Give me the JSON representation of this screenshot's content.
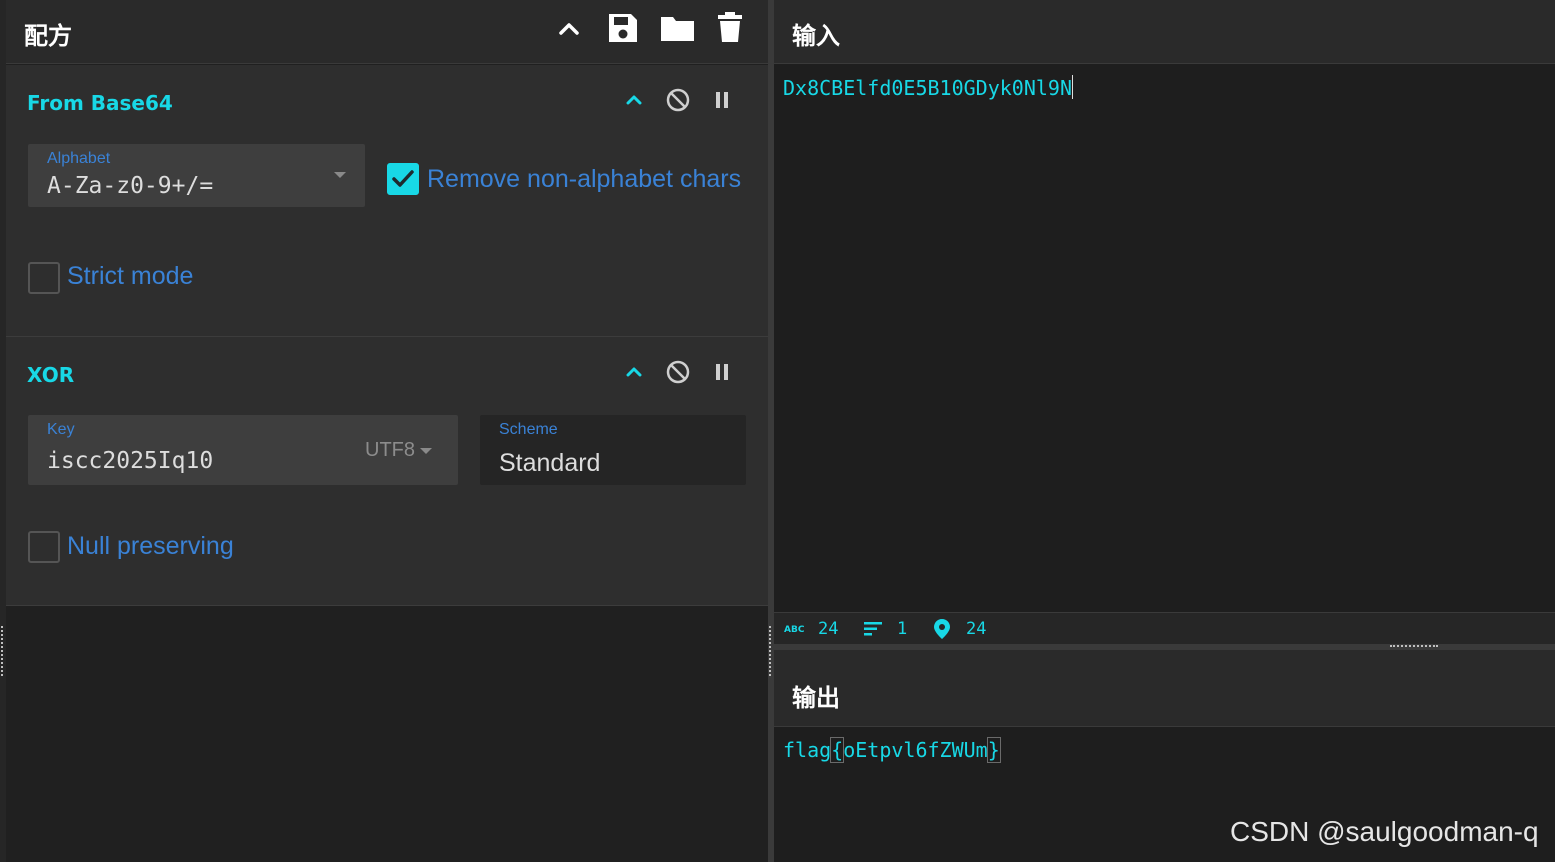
{
  "recipe": {
    "title": "配方",
    "header_icons": [
      "chevron-up-icon",
      "save-icon",
      "folder-icon",
      "trash-icon"
    ],
    "operations": [
      {
        "name": "From Base64",
        "alphabet": {
          "label": "Alphabet",
          "value": "A-Za-z0-9+/="
        },
        "remove_non_alphabet": {
          "label": "Remove non-alphabet chars",
          "checked": true
        },
        "strict_mode": {
          "label": "Strict mode",
          "checked": false
        }
      },
      {
        "name": "XOR",
        "key": {
          "label": "Key",
          "value": "iscc2025Iq10",
          "encoding": "UTF8"
        },
        "scheme": {
          "label": "Scheme",
          "value": "Standard"
        },
        "null_preserving": {
          "label": "Null preserving",
          "checked": false
        }
      }
    ]
  },
  "input": {
    "title": "输入",
    "text": "Dx8CBElfd0E5B10GDyk0Nl9N",
    "stats": {
      "length": "24",
      "lines": "1",
      "position": "24"
    }
  },
  "output": {
    "title": "输出",
    "text_prefix": "flag",
    "text_open": "{",
    "text_body": "oEtpvl6fZWUm",
    "text_close": "}"
  },
  "watermark": "CSDN @saulgoodman-q",
  "colors": {
    "accent": "#18d8e6",
    "label_blue": "#3a82d6",
    "background": "#1e1e1e"
  }
}
